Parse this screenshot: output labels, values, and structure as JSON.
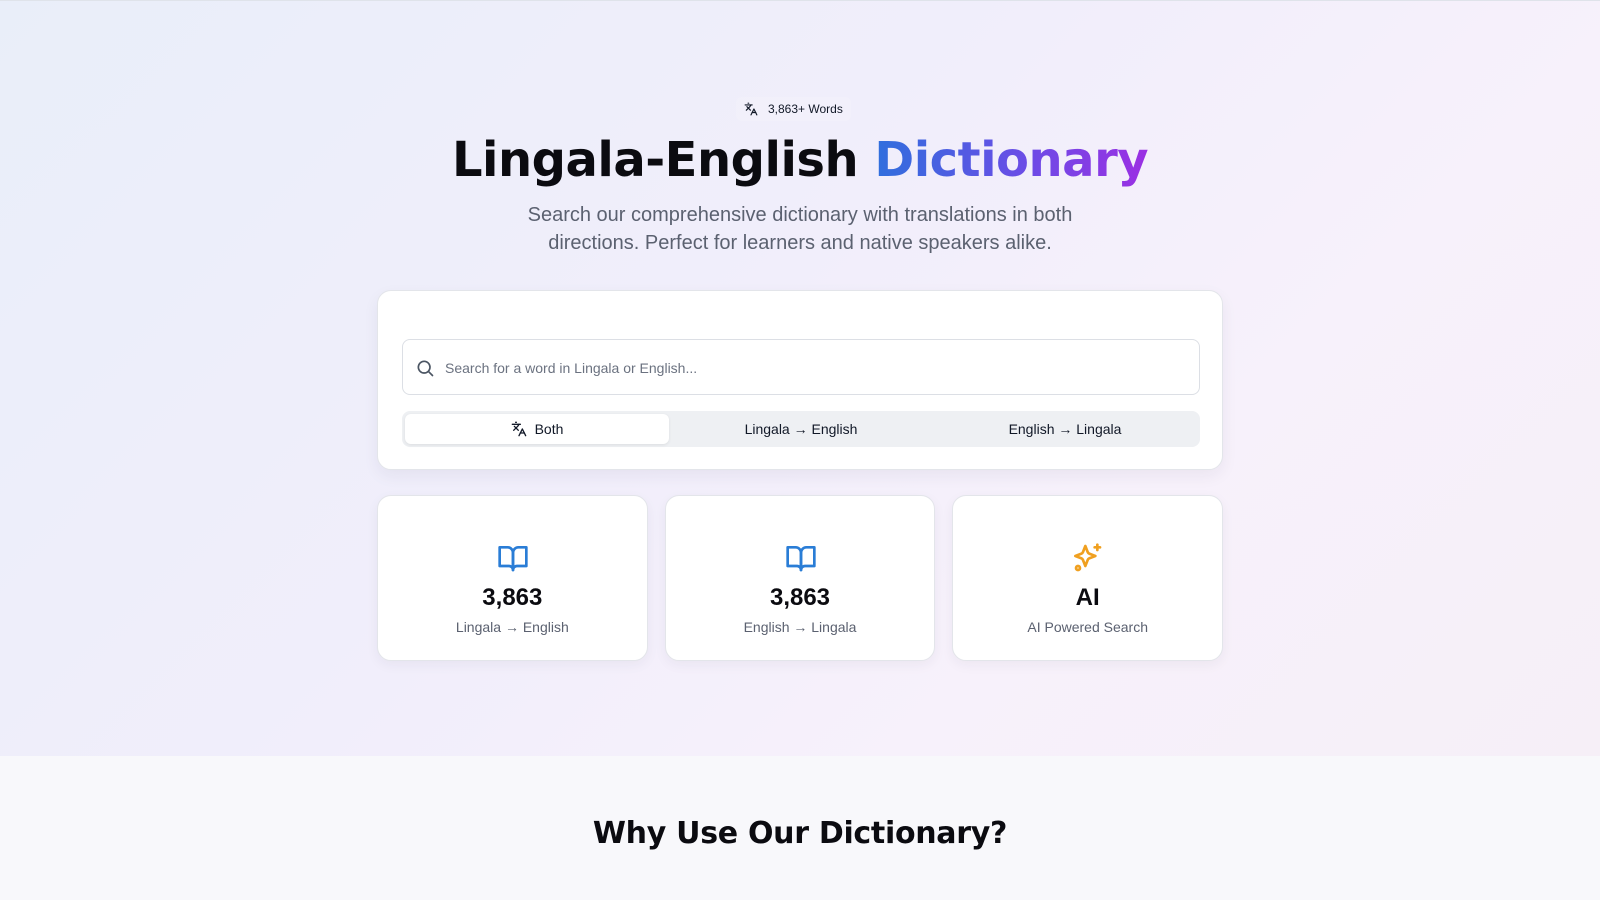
{
  "hero": {
    "badge": {
      "icon": "languages-icon",
      "text": "3,863+ Words"
    },
    "title_main": "Lingala-English",
    "title_accent": "Dictionary",
    "subtitle": "Search our comprehensive dictionary with translations in both directions. Perfect for learners and native speakers alike."
  },
  "search": {
    "icon": "search-icon",
    "placeholder": "Search for a word in Lingala or English...",
    "value": "",
    "tabs": [
      {
        "label": "Both",
        "icon": "languages-icon",
        "active": true
      },
      {
        "label": "Lingala → English",
        "active": false
      },
      {
        "label": "English → Lingala",
        "active": false
      }
    ]
  },
  "stats": [
    {
      "icon": "book-open-icon",
      "value": "3,863",
      "label": "Lingala → English"
    },
    {
      "icon": "book-open-icon",
      "value": "3,863",
      "label": "English → Lingala"
    },
    {
      "icon": "sparkles-icon",
      "value": "AI",
      "label": "AI Powered Search"
    }
  ],
  "why_section": {
    "title": "Why Use Our Dictionary?"
  },
  "colors": {
    "accent_blue": "#2f6fdd",
    "accent_purple": "#9b2fe3",
    "book_icon": "#2a7dd6",
    "sparkles_icon": "#f0a020"
  }
}
